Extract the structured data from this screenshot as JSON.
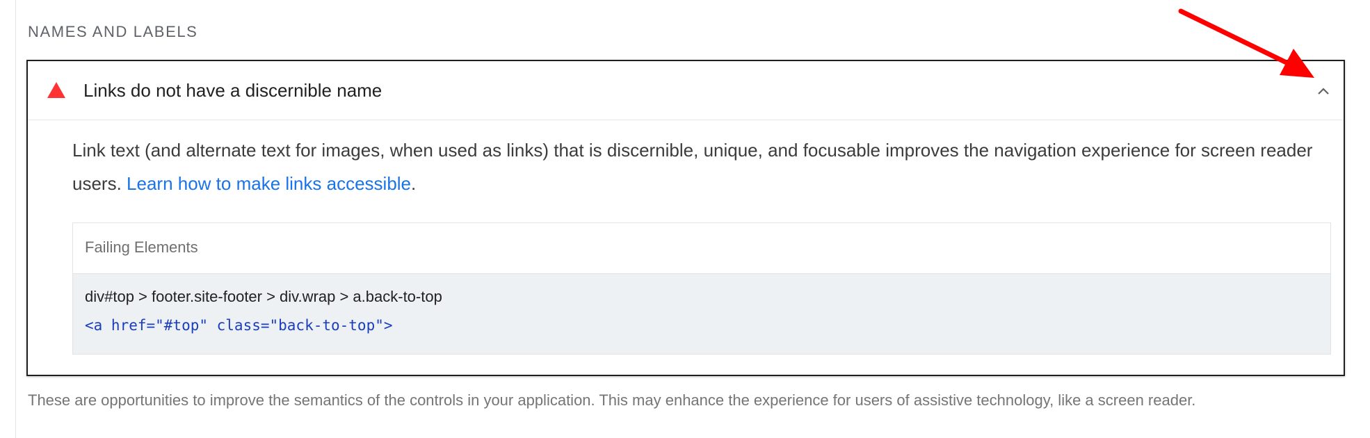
{
  "group": {
    "title": "NAMES AND LABELS",
    "description": "These are opportunities to improve the semantics of the controls in your application. This may enhance the experience for users of assistive technology, like a screen reader."
  },
  "audit": {
    "status_icon": "fail-triangle-icon",
    "status_color": "#ff3333",
    "title": "Links do not have a discernible name",
    "toggle_icon": "chevron-up-icon",
    "description_text": "Link text (and alternate text for images, when used as links) that is discernible, unique, and focusable improves the navigation experience for screen reader users. ",
    "learn_more_link": "Learn how to make links accessible",
    "description_end": ".",
    "link_color": "#1a73e8"
  },
  "details": {
    "header": "Failing Elements",
    "rows": [
      {
        "selector": "div#top > footer.site-footer > div.wrap > a.back-to-top",
        "snippet": "<a href=\"#top\" class=\"back-to-top\">"
      }
    ]
  },
  "annotation": {
    "arrow_icon": "red-arrow-icon",
    "arrow_color": "#ff0000"
  }
}
